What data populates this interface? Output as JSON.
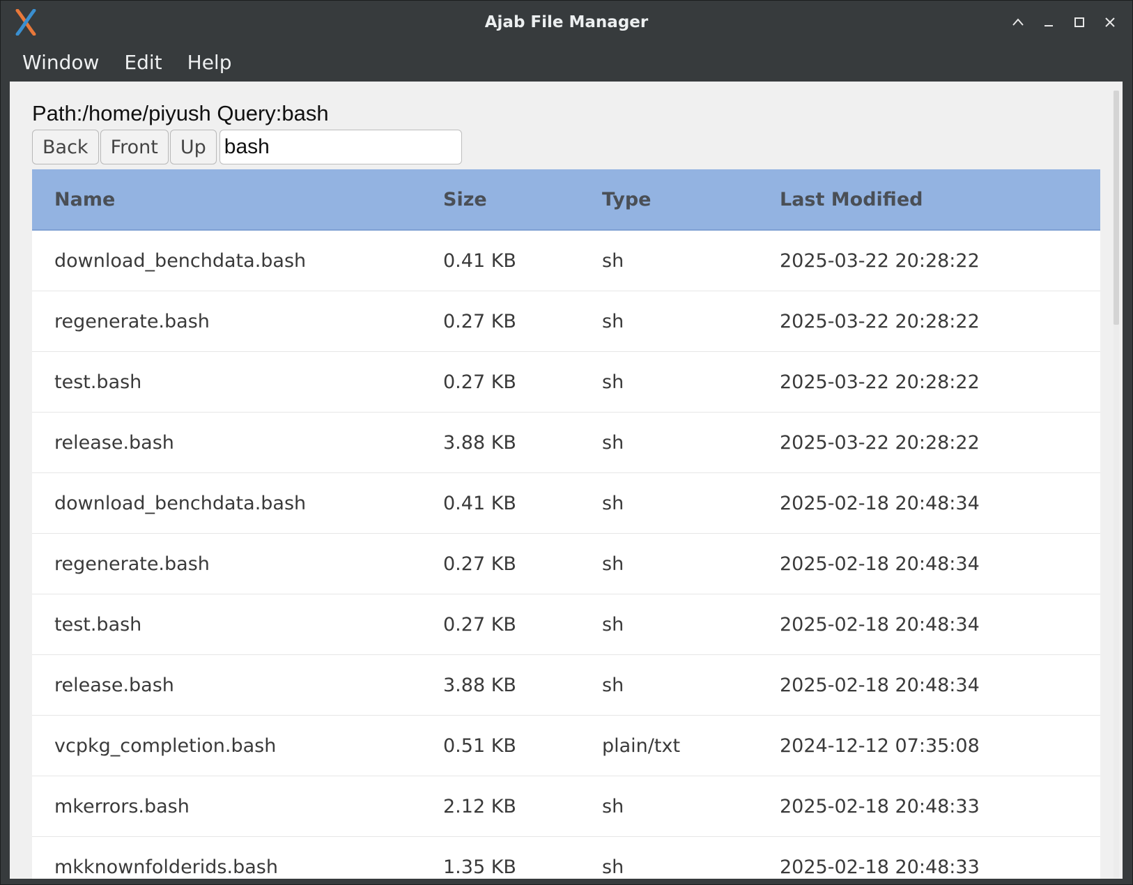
{
  "window": {
    "title": "Ajab File Manager"
  },
  "menubar": {
    "items": [
      "Window",
      "Edit",
      "Help"
    ]
  },
  "path_label": "Path:/home/piyush Query:bash",
  "toolbar": {
    "back_label": "Back",
    "front_label": "Front",
    "up_label": "Up",
    "search_value": "bash"
  },
  "table": {
    "columns": [
      "Name",
      "Size",
      "Type",
      "Last Modified"
    ],
    "rows": [
      {
        "name": "download_benchdata.bash",
        "size": "0.41 KB",
        "type": "sh",
        "modified": "2025-03-22 20:28:22"
      },
      {
        "name": "regenerate.bash",
        "size": "0.27 KB",
        "type": "sh",
        "modified": "2025-03-22 20:28:22"
      },
      {
        "name": "test.bash",
        "size": "0.27 KB",
        "type": "sh",
        "modified": "2025-03-22 20:28:22"
      },
      {
        "name": "release.bash",
        "size": "3.88 KB",
        "type": "sh",
        "modified": "2025-03-22 20:28:22"
      },
      {
        "name": "download_benchdata.bash",
        "size": "0.41 KB",
        "type": "sh",
        "modified": "2025-02-18 20:48:34"
      },
      {
        "name": "regenerate.bash",
        "size": "0.27 KB",
        "type": "sh",
        "modified": "2025-02-18 20:48:34"
      },
      {
        "name": "test.bash",
        "size": "0.27 KB",
        "type": "sh",
        "modified": "2025-02-18 20:48:34"
      },
      {
        "name": "release.bash",
        "size": "3.88 KB",
        "type": "sh",
        "modified": "2025-02-18 20:48:34"
      },
      {
        "name": "vcpkg_completion.bash",
        "size": "0.51 KB",
        "type": "plain/txt",
        "modified": "2024-12-12 07:35:08"
      },
      {
        "name": "mkerrors.bash",
        "size": "2.12 KB",
        "type": "sh",
        "modified": "2025-02-18 20:48:33"
      },
      {
        "name": "mkknownfolderids.bash",
        "size": "1.35 KB",
        "type": "sh",
        "modified": "2025-02-18 20:48:33"
      }
    ]
  },
  "colors": {
    "titlebar_bg": "#373b3d",
    "header_bg": "#93b3e1",
    "content_bg": "#f0f0f0",
    "row_bg": "#ffffff"
  },
  "icons": {
    "app": "dna-helix-icon",
    "collapse": "chevron-up-icon",
    "minimize": "minimize-icon",
    "maximize": "maximize-icon",
    "close": "close-icon"
  }
}
